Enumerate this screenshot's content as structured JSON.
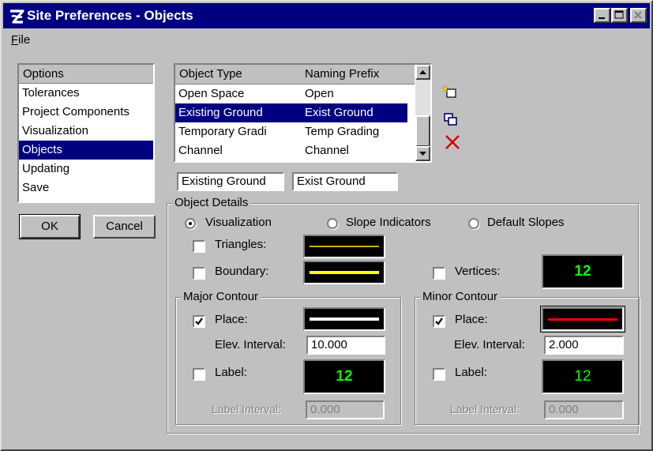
{
  "window": {
    "title": "Site Preferences - Objects"
  },
  "menu": {
    "file_prefix": "F",
    "file_rest": "ile"
  },
  "options": {
    "header": "Options",
    "items": [
      "Tolerances",
      "Project Components",
      "Visualization",
      "Objects",
      "Updating",
      "Save"
    ],
    "selected": "Objects"
  },
  "buttons": {
    "ok": "OK",
    "cancel": "Cancel"
  },
  "object_list": {
    "col_type": "Object Type",
    "col_prefix": "Naming Prefix",
    "rows": [
      {
        "type": "Open Space",
        "prefix": "Open"
      },
      {
        "type": "Existing Ground",
        "prefix": "Exist Ground"
      },
      {
        "type": "Temporary Gradi",
        "prefix": "Temp Grading"
      },
      {
        "type": "Channel",
        "prefix": "Channel"
      }
    ],
    "selected": "Existing Ground"
  },
  "edit": {
    "type_value": "Existing Ground",
    "prefix_value": "Exist Ground"
  },
  "details": {
    "group_label": "Object Details",
    "radio_visualization": "Visualization",
    "radio_slope_indicators": "Slope Indicators",
    "radio_default_slopes": "Default Slopes",
    "selected_radio": "Visualization",
    "triangles_label": "Triangles:",
    "boundary_label": "Boundary:",
    "vertices_label": "Vertices:",
    "symbol_text": "12"
  },
  "major": {
    "group_label": "Major Contour",
    "place_label": "Place:",
    "place_checked": true,
    "elev_label": "Elev. Interval:",
    "elev_value": "10.000",
    "label_label": "Label:",
    "label_interval_label": "Label Interval:",
    "label_interval_value": "0.000"
  },
  "minor": {
    "group_label": "Minor Contour",
    "place_label": "Place:",
    "place_checked": true,
    "elev_label": "Elev. Interval:",
    "elev_value": "2.000",
    "label_label": "Label:",
    "label_interval_label": "Label Interval:",
    "label_interval_value": "0.000"
  },
  "colors": {
    "titlebar": "#000080",
    "selection": "#000080",
    "triangles_line": "#c8b400",
    "boundary_line": "#ffff00",
    "major_line": "#ffffff",
    "minor_line": "#ff0000",
    "symbol": "#00ff00"
  },
  "icons": [
    "app-logo-icon",
    "minimize-icon",
    "maximize-icon",
    "close-icon",
    "new-object-icon",
    "copy-object-icon",
    "delete-x-icon",
    "scroll-up-icon",
    "scroll-down-icon",
    "checkbox-check-icon"
  ]
}
